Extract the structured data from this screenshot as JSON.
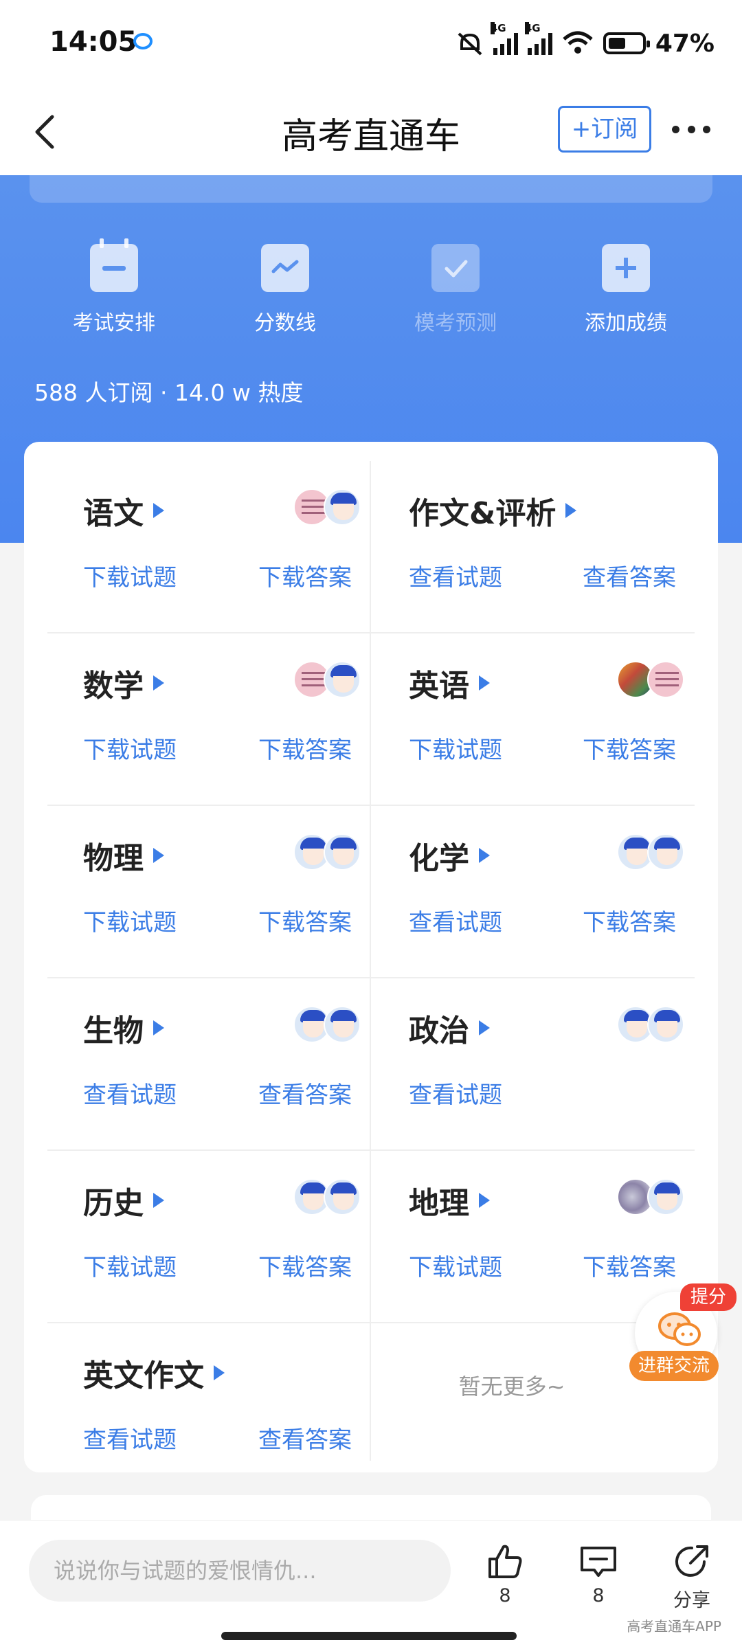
{
  "status_bar": {
    "time": "14:05",
    "battery_percent": "47%",
    "net1": "4G",
    "net2": "4G"
  },
  "nav": {
    "title": "高考直通车",
    "subscribe_label": "+订阅"
  },
  "actions": [
    {
      "label": "考试安排",
      "icon": "calendar-minus-icon",
      "enabled": true
    },
    {
      "label": "分数线",
      "icon": "trend-line-icon",
      "enabled": true
    },
    {
      "label": "模考预测",
      "icon": "checklist-icon",
      "enabled": false
    },
    {
      "label": "添加成绩",
      "icon": "plus-icon",
      "enabled": true
    }
  ],
  "subscription_info": "588 人订阅 · 14.0 w 热度",
  "subjects": [
    {
      "name": "语文",
      "link1": "下载试题",
      "link2": "下载答案"
    },
    {
      "name": "作文&评析",
      "link1": "查看试题",
      "link2": "查看答案"
    },
    {
      "name": "数学",
      "link1": "下载试题",
      "link2": "下载答案"
    },
    {
      "name": "英语",
      "link1": "下载试题",
      "link2": "下载答案"
    },
    {
      "name": "物理",
      "link1": "下载试题",
      "link2": "下载答案"
    },
    {
      "name": "化学",
      "link1": "查看试题",
      "link2": "下载答案"
    },
    {
      "name": "生物",
      "link1": "查看试题",
      "link2": "查看答案"
    },
    {
      "name": "政治",
      "link1": "查看试题",
      "link2": ""
    },
    {
      "name": "历史",
      "link1": "下载试题",
      "link2": "下载答案"
    },
    {
      "name": "地理",
      "link1": "下载试题",
      "link2": "下载答案"
    },
    {
      "name": "英文作文",
      "link1": "查看试题",
      "link2": "查看答案"
    }
  ],
  "no_more_text": "暂无更多~",
  "float_button": {
    "tag": "提分",
    "label": "进群交流"
  },
  "bottom_bar": {
    "comment_placeholder": "说说你与试题的爱恨情仇...",
    "like_count": "8",
    "comment_count": "8",
    "share_label": "分享",
    "watermark": "高考直通车APP"
  },
  "colors": {
    "accent": "#3b7de6",
    "hero_blue": "#4b86ef",
    "tag_red": "#ef4136",
    "orange": "#f28a2e"
  }
}
